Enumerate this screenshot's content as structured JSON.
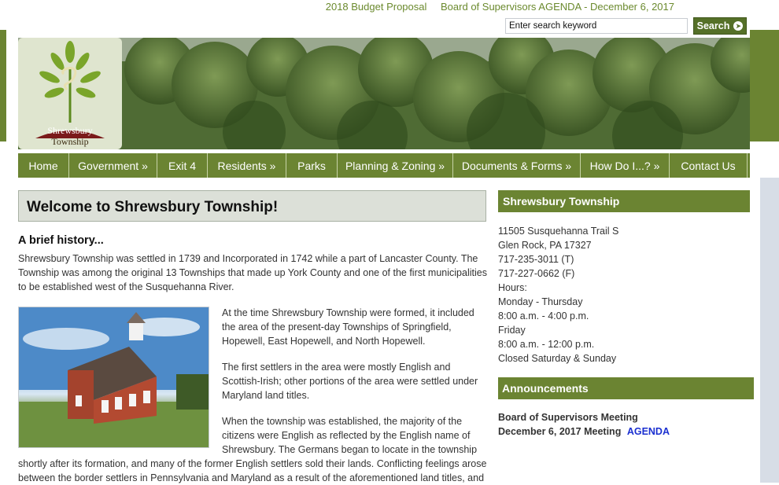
{
  "top_links": [
    "2018 Budget Proposal",
    "Board of Supervisors AGENDA - December 6, 2017"
  ],
  "search": {
    "placeholder": "Enter search keyword",
    "button_label": "Search"
  },
  "logo": {
    "line1": "Shrewsbury",
    "line2": "Township"
  },
  "nav": [
    "Home",
    "Government »",
    "Exit 4",
    "Residents »",
    "Parks",
    "Planning & Zoning »",
    "Documents & Forms »",
    "How Do I...? »",
    "Contact Us"
  ],
  "main": {
    "welcome_title": "Welcome to Shrewsbury Township!",
    "brief_title": "A brief history...",
    "p1": "Shrewsbury Township was  settled in 1739 and Incorporated in 1742 while a part of Lancaster County.  The Township was among the original 13 Townships that made up York County and one of the first municipalities to be established west of the Susquehanna River.",
    "p2": "At the time Shrewsbury Township were formed, it included the area of the present-day Townships of Springfield, Hopewell, East Hopewell, and North Hopewell.",
    "p3": "The first settlers in the area were mostly English and Scottish-Irish; other portions of the area were settled under Maryland land titles.",
    "p4": "When the township was established, the majority of the citizens were English as reflected by the English name of Shrewsbury. The Germans began to locate in the township",
    "p5": "shortly after its formation, and many of the former English settlers sold their lands. Conflicting feelings arose between the border settlers in Pennsylvania and Maryland as a result of the aforementioned land titles, and"
  },
  "right": {
    "heading": "Shrewsbury Township",
    "lines": [
      "11505 Susquehanna Trail S",
      "Glen Rock, PA 17327",
      "717-235-3011 (T)",
      "717-227-0662 (F)",
      "Hours:",
      "Monday - Thursday",
      "8:00 a.m. - 4:00 p.m.",
      "Friday",
      "8:00 a.m. - 12:00 p.m.",
      "Closed Saturday & Sunday"
    ],
    "ann_heading": "Announcements",
    "ann_line1": "Board of Supervisors Meeting",
    "ann_line2": "December 6, 2017 Meeting",
    "ann_link": "AGENDA"
  },
  "colors": {
    "accent": "#6b8432",
    "link_blue": "#1a2fd0",
    "welcome_bg": "#dce0d8"
  }
}
